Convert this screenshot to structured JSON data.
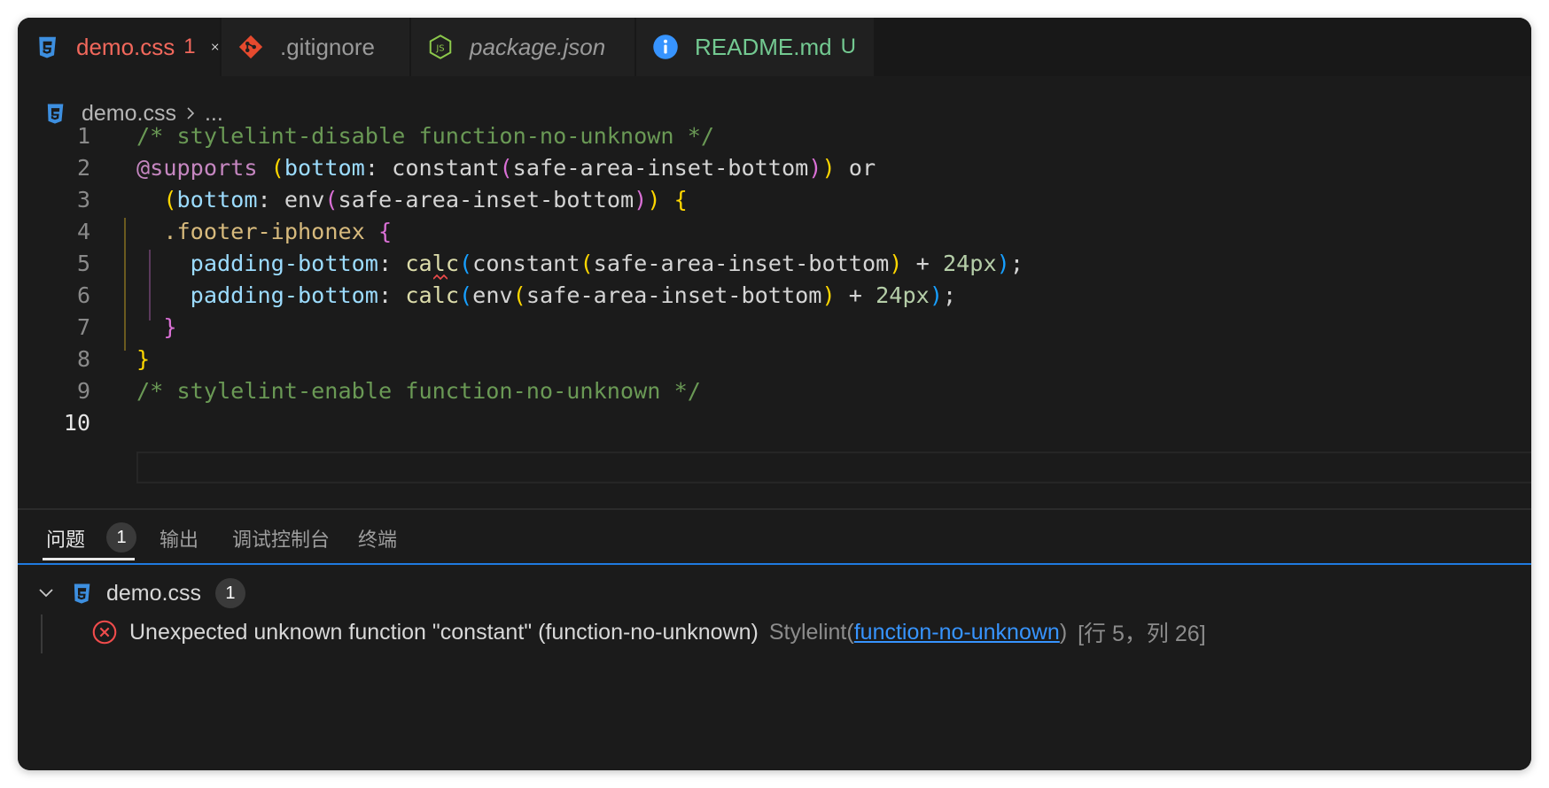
{
  "tabs": [
    {
      "label": "demo.css",
      "badge": "1",
      "icon": "css-icon"
    },
    {
      "label": ".gitignore",
      "icon": "git-icon"
    },
    {
      "label": "package.json",
      "icon": "nodejs-icon"
    },
    {
      "label": "README.md",
      "badge": "U",
      "icon": "info-icon"
    }
  ],
  "breadcrumb": {
    "file": "demo.css",
    "more": "..."
  },
  "editor": {
    "line_numbers": [
      "1",
      "2",
      "3",
      "4",
      "5",
      "6",
      "7",
      "8",
      "9",
      "10"
    ],
    "lines": {
      "l1": "/* stylelint-disable function-no-unknown */",
      "l2_at": "@supports",
      "l2_p1": "(",
      "l2_prop": "bottom",
      "l2_colon": ": ",
      "l2_fn": "constant",
      "l2_p2": "(",
      "l2_arg": "safe-area-inset-bottom",
      "l2_p3": ")",
      "l2_p4": ")",
      "l2_or": " or",
      "l3_p1": "(",
      "l3_prop": "bottom",
      "l3_colon": ": ",
      "l3_fn": "env",
      "l3_p2": "(",
      "l3_arg": "safe-area-inset-bottom",
      "l3_p3": ")",
      "l3_p4": ")",
      "l3_brace": "{",
      "l4_sel": ".footer-iphonex",
      "l4_brace": "{",
      "l5_prop": "padding-bottom",
      "l5_colon": ": ",
      "l5_fn": "calc",
      "l5_p1": "(",
      "l5_fn2": "constant",
      "l5_p2": "(",
      "l5_arg": "safe-area-inset-bottom",
      "l5_p3": ")",
      "l5_plus": " + ",
      "l5_num": "24px",
      "l5_p4": ")",
      "l5_semi": ";",
      "l6_prop": "padding-bottom",
      "l6_colon": ": ",
      "l6_fn": "calc",
      "l6_p1": "(",
      "l6_fn2": "env",
      "l6_p2": "(",
      "l6_arg": "safe-area-inset-bottom",
      "l6_p3": ")",
      "l6_plus": " + ",
      "l6_num": "24px",
      "l6_p4": ")",
      "l6_semi": ";",
      "l7": "}",
      "l8": "}",
      "l9": "/* stylelint-enable function-no-unknown */"
    }
  },
  "panel": {
    "tabs": [
      "问题",
      "输出",
      "调试控制台",
      "终端"
    ],
    "problem_count": "1",
    "file": {
      "name": "demo.css",
      "count": "1"
    },
    "problem": {
      "message": "Unexpected unknown function \"constant\" (function-no-unknown)",
      "source": "Stylelint(",
      "link": "function-no-unknown",
      "source_end": ")",
      "location": "[行 5，列 26]"
    }
  },
  "colors": {
    "error": "#f14c4c",
    "modified": "#f2685c",
    "untracked": "#73c991",
    "focus_border": "#1f7ae0"
  }
}
